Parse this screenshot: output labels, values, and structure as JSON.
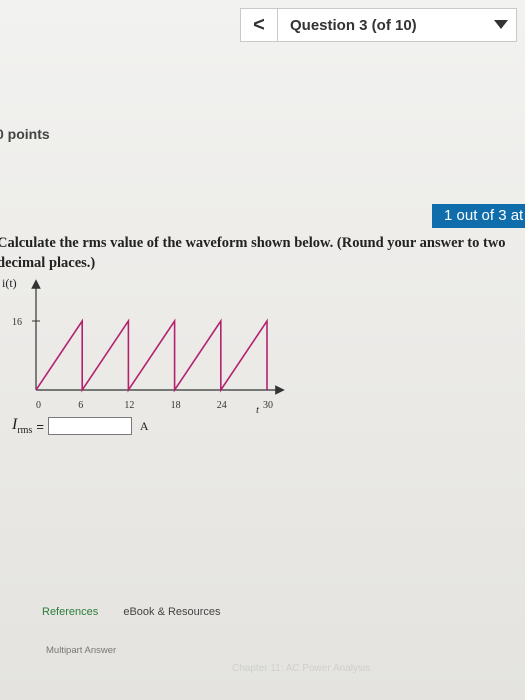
{
  "nav": {
    "prev_icon": "chevron-left-icon",
    "prev_glyph": "<",
    "question_title": "Question 3 (of 10)",
    "dropdown_icon": "caret-down-icon"
  },
  "points_label": "0 points",
  "attempt_badge": "1 out of 3 at",
  "question_text": "Calculate the rms value of the waveform shown below. (Round your answer to two decimal places.)",
  "graph": {
    "y_label": "i(t)",
    "y_tick": "16",
    "x_ticks": [
      "0",
      "6",
      "12",
      "18",
      "24",
      "30"
    ],
    "x_label": "t"
  },
  "answer": {
    "label": "I",
    "subscript": "rms",
    "equals": "=",
    "value": "",
    "unit": "A"
  },
  "tabs": {
    "references": "References",
    "ebook": "eBook & Resources"
  },
  "multipart": "Multipart Answer",
  "chapter": "Chapter 11: AC Power Analysis",
  "colors": {
    "accent": "#0f6dab",
    "waveform": "#b3226e",
    "references": "#2d7d3d"
  }
}
